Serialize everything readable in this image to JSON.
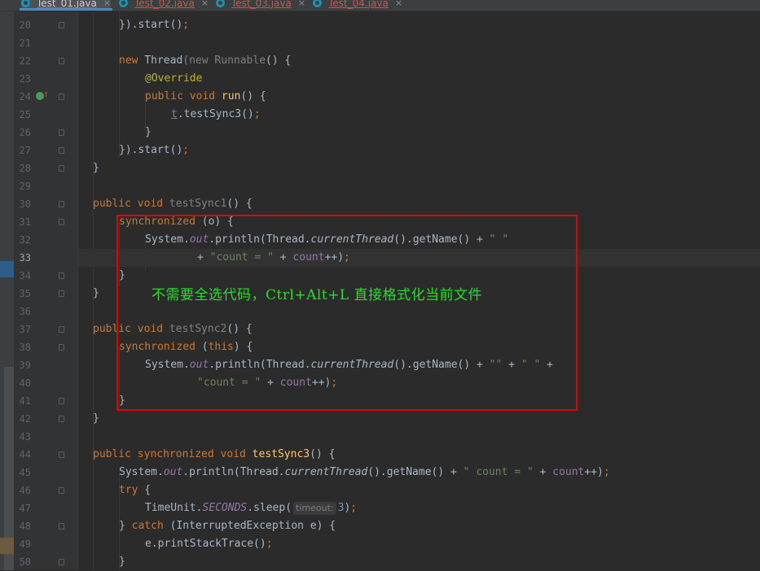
{
  "tabs": [
    {
      "label": "Test_01.java",
      "active": true
    },
    {
      "label": "Test_02.java",
      "active": false
    },
    {
      "label": "Test_03.java",
      "active": false
    },
    {
      "label": "Test_04.java",
      "active": false
    }
  ],
  "tab_close_glyph": "×",
  "annotation_note": "不需要全选代码，Ctrl+Alt+L 直接格式化当前文件",
  "colors": {
    "keyword": "#cc7832",
    "string": "#6a8759",
    "annotation": "#bbb529",
    "method_decl": "#ffc66d",
    "field": "#9876aa",
    "highlight_box": "#e60000",
    "note_text": "#2cdc2c"
  },
  "icons": [
    "java-class-icon",
    "close-icon",
    "run-gutter-icon",
    "override-arrow-icon",
    "fold-marker-icon"
  ],
  "param_hint": "timeout:",
  "line_numbers": [
    "20",
    "21",
    "22",
    "23",
    "24",
    "25",
    "26",
    "27",
    "28",
    "29",
    "30",
    "31",
    "32",
    "33",
    "34",
    "35",
    "36",
    "37",
    "38",
    "39",
    "40",
    "41",
    "42",
    "43",
    "44",
    "45",
    "46",
    "47",
    "48",
    "49",
    "50"
  ],
  "current_line": "33",
  "code": {
    "l20": {
      "a": "}).start",
      "b": "()",
      "c": ";"
    },
    "l22": {
      "kw1": "new ",
      "cls": "Thread",
      "p1": "(",
      "kw2": "new ",
      "cls2": "Runnable",
      "p2": "() {"
    },
    "l23": {
      "ann": "@Override"
    },
    "l24": {
      "kw": "public void ",
      "fn": "run",
      "rest": "() {"
    },
    "l25": {
      "t": "t",
      "rest": ".testSync3()",
      "semi": ";"
    },
    "l26": {
      "rest": "}"
    },
    "l27": {
      "a": "}).start()",
      "semi": ";"
    },
    "l28": {
      "rest": "}"
    },
    "l30": {
      "kw": "public void ",
      "name": "testSync1",
      "rest": "() {"
    },
    "l31": {
      "kw": "synchronized ",
      "rest": "(o) {"
    },
    "l32": {
      "a": "System.",
      "out": "out",
      "b": ".println(Thread.",
      "ct": "currentThread",
      "c": "().getName() + ",
      "s": "\" \""
    },
    "l33": {
      "plus": "+ ",
      "s": "\"count = \"",
      "mid": " + ",
      "f": "count",
      "end": "++)",
      "semi": ";"
    },
    "l34": {
      "rest": "}"
    },
    "l35": {
      "rest": "}"
    },
    "l37": {
      "kw": "public void ",
      "name": "testSync2",
      "rest": "() {"
    },
    "l38": {
      "kw": "synchronized ",
      "p1": "(",
      "kw2": "this",
      "p2": ") {"
    },
    "l39": {
      "a": "System.",
      "out": "out",
      "b": ".println(Thread.",
      "ct": "currentThread",
      "c": "().getName() + ",
      "s1": "\"\"",
      "m": " + ",
      "s2": "\" \"",
      "e": " +"
    },
    "l40": {
      "s": "\"count = \"",
      "mid": " + ",
      "f": "count",
      "end": "++)",
      "semi": ";"
    },
    "l41": {
      "rest": "}"
    },
    "l42": {
      "rest": "}"
    },
    "l44": {
      "kw": "public synchronized void ",
      "fn": "testSync3",
      "rest": "() {"
    },
    "l45": {
      "a": "System.",
      "out": "out",
      "b": ".println(Thread.",
      "ct": "currentThread",
      "c": "().getName() + ",
      "s": "\" count = \"",
      "mid": " + ",
      "f": "count",
      "end": "++)",
      "semi": ";"
    },
    "l46": {
      "kw": "try",
      "rest": " {"
    },
    "l47": {
      "a": "TimeUnit.",
      "sec": "SECONDS",
      "b": ".sleep(",
      "num": "3",
      "end": ")",
      "semi": ";"
    },
    "l48": {
      "p1": "} ",
      "kw": "catch",
      "rest": " (InterruptedException e) {"
    },
    "l49": {
      "a": "e.printStackTrace()",
      "semi": ";"
    },
    "l50": {
      "rest": "}"
    }
  }
}
